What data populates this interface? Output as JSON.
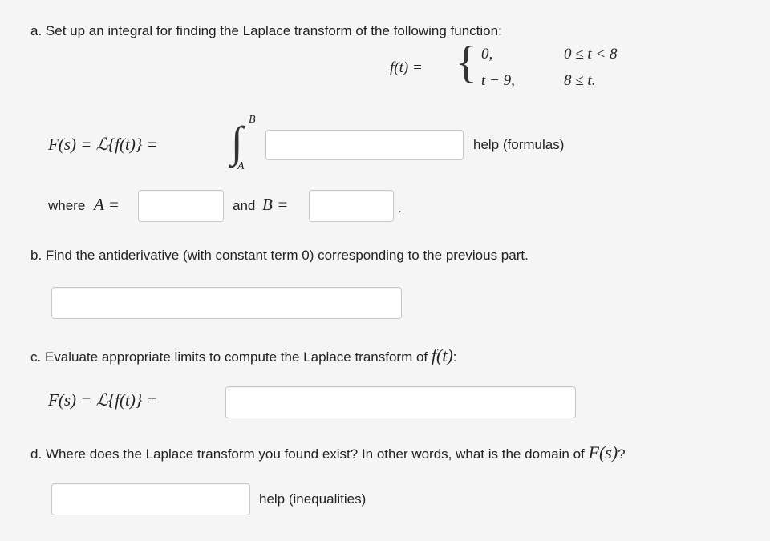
{
  "part_a": {
    "question": "a. Set up an integral for finding the Laplace transform of the following function:",
    "func_lhs": "f(t) =",
    "case1_value": "0,",
    "case1_condition": "0 ≤ t < 8",
    "case2_value": "t − 9,",
    "case2_condition": "8 ≤ t.",
    "transform_lhs": "F(s) = ℒ{f(t)} =",
    "integral_upper": "B",
    "integral_lower": "A",
    "help_label": "help (formulas)",
    "where_label": "where",
    "a_symbol": "A =",
    "and_label": "and",
    "b_symbol": "B =",
    "period": "."
  },
  "part_b": {
    "question": "b. Find the antiderivative (with constant term 0) corresponding to the previous part."
  },
  "part_c": {
    "question_prefix": "c. Evaluate appropriate limits to compute the Laplace transform of",
    "question_math": "f(t)",
    "question_suffix": ":",
    "transform_lhs": "F(s) = ℒ{f(t)} ="
  },
  "part_d": {
    "question_prefix": "d. Where does the Laplace transform you found exist? In other words, what is the domain of",
    "question_math": "F(s)",
    "question_suffix": "?",
    "help_label": "help (inequalities)"
  }
}
